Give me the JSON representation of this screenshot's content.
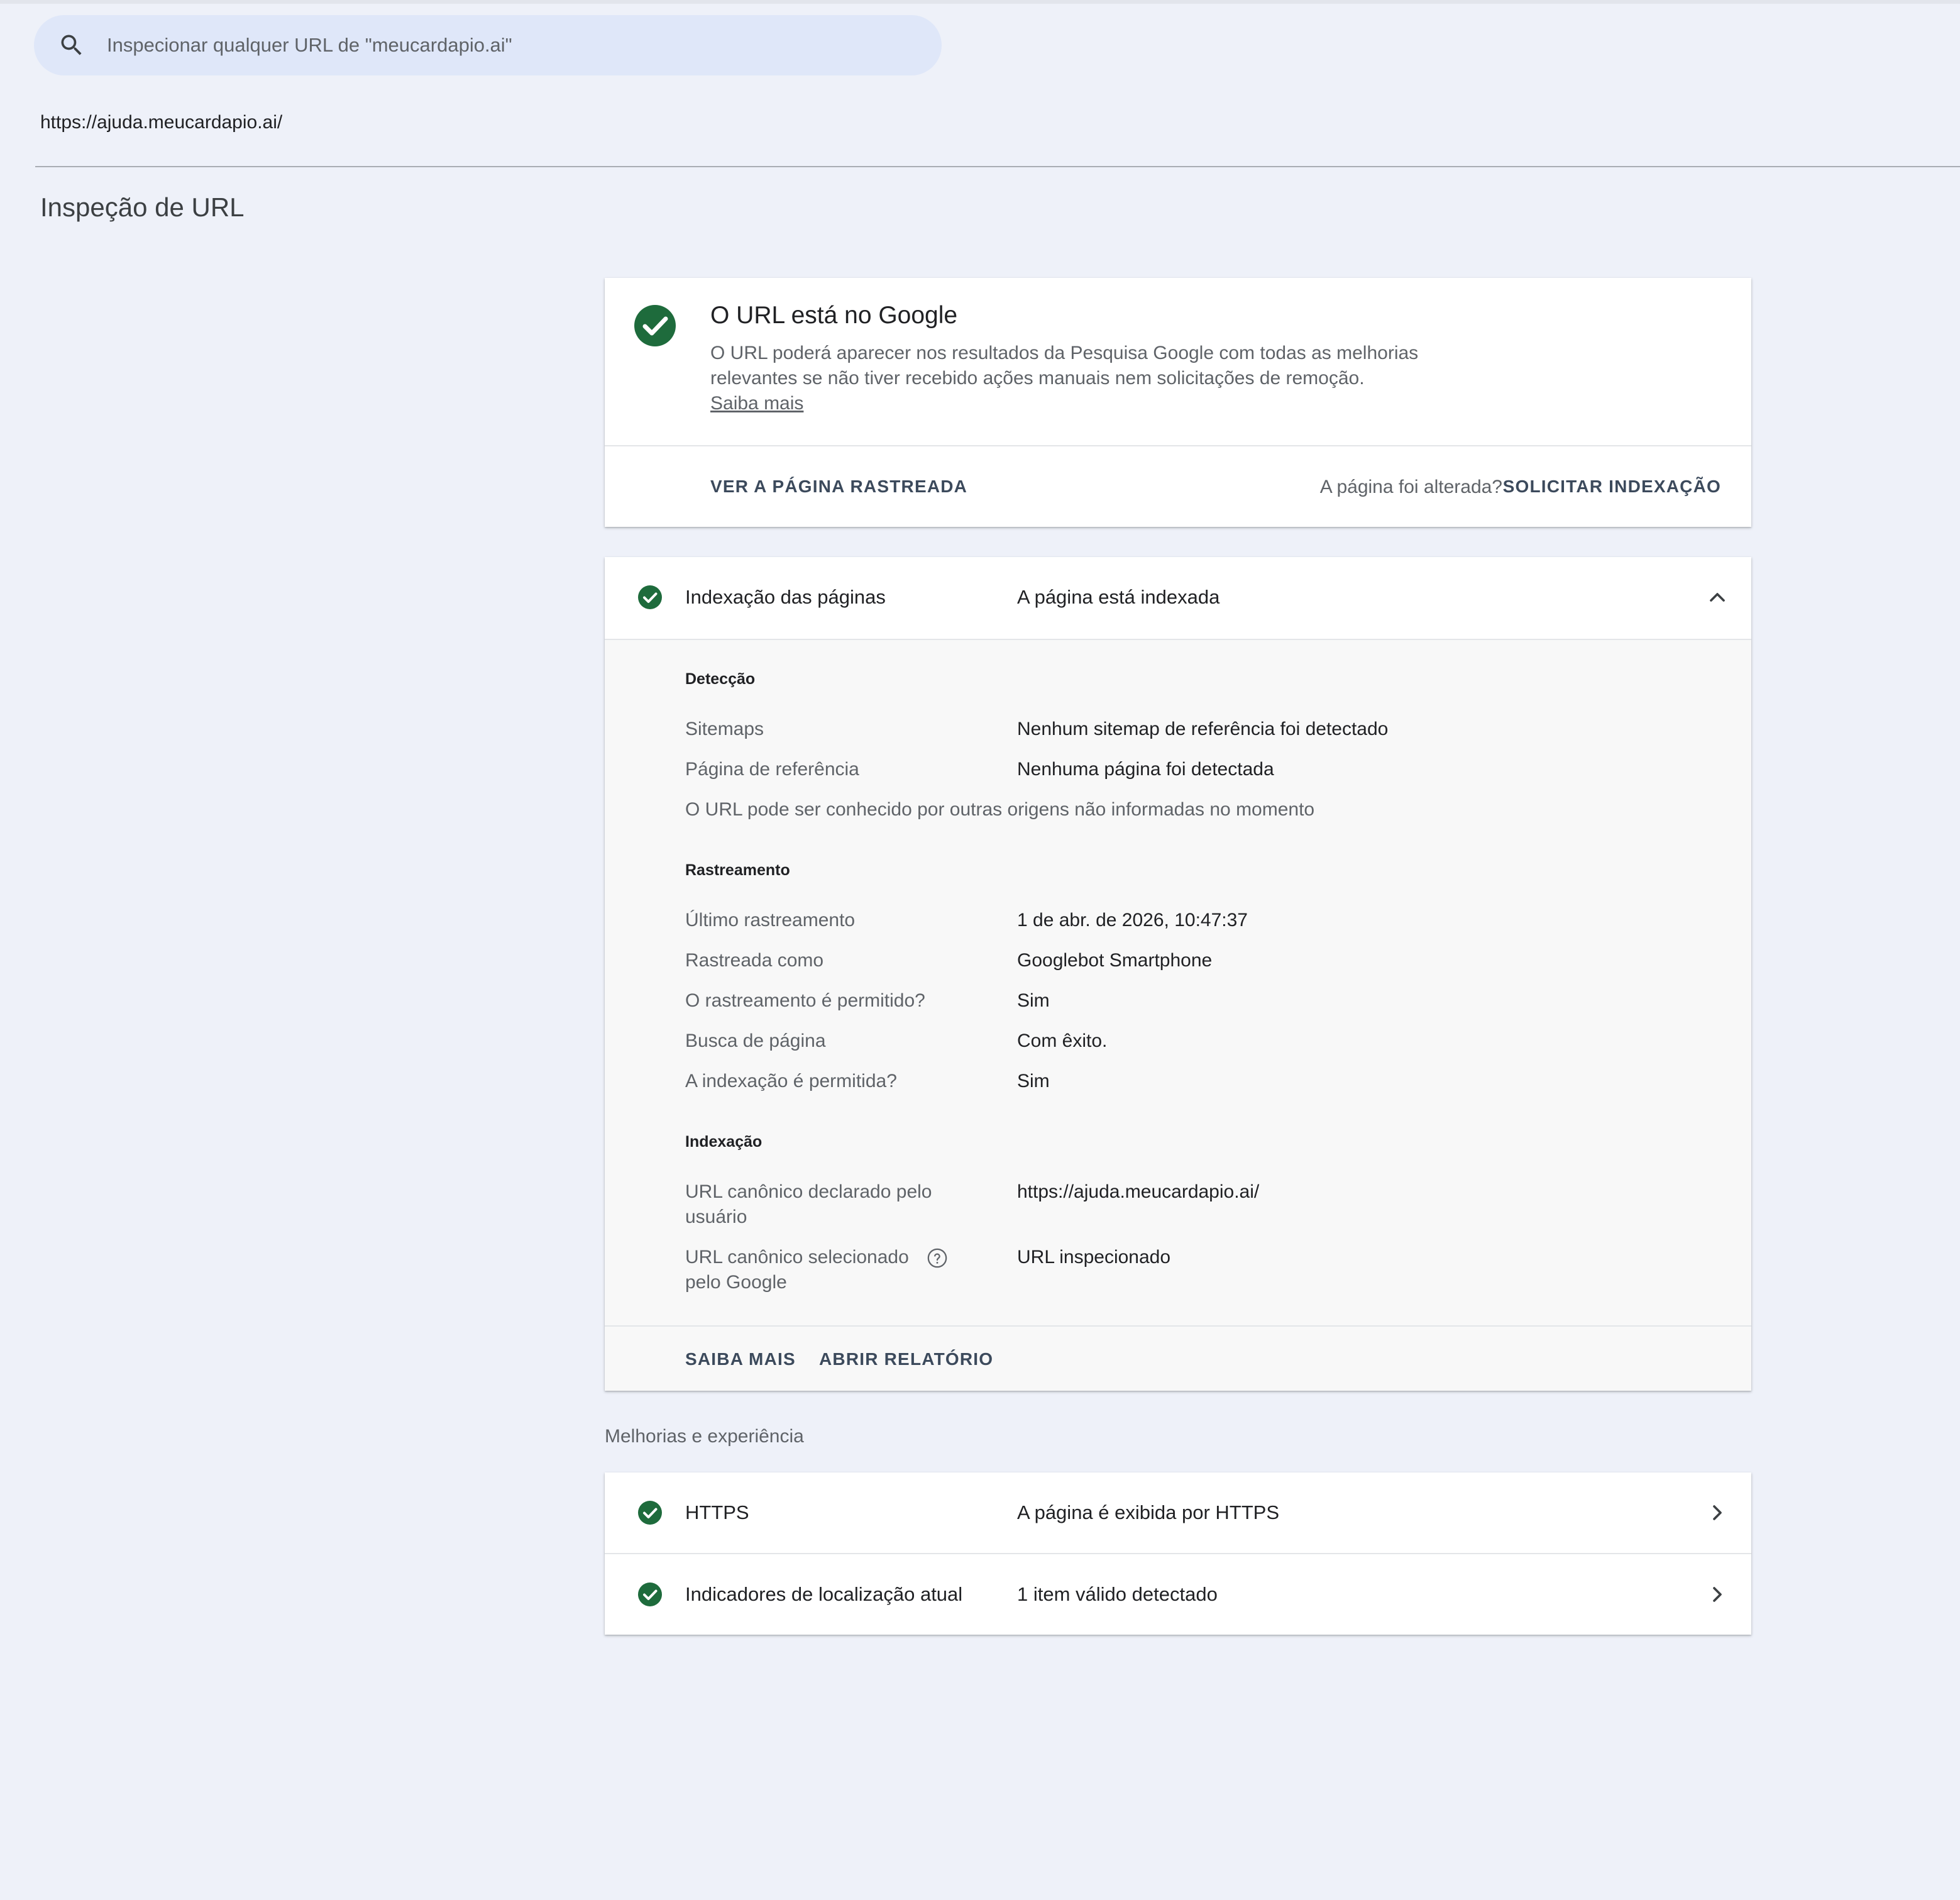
{
  "search": {
    "placeholder": "Inspecionar qualquer URL de \"meucardapio.ai\""
  },
  "inspected_url": "https://ajuda.meucardapio.ai/",
  "page_title": "Inspeção de URL",
  "status": {
    "title": "O URL está no Google",
    "description_line1": "O URL poderá aparecer nos resultados da Pesquisa Google com todas as melhorias",
    "description_line2": "relevantes se não tiver recebido ações manuais nem solicitações de remoção.",
    "learn_more": "Saiba mais",
    "view_crawled_label": "VER A PÁGINA RASTREADA",
    "page_changed_text": "A página foi alterada?",
    "request_indexing_label": "SOLICITAR INDEXAÇÃO",
    "status_color": "#1e6b3c"
  },
  "indexing": {
    "label": "Indexação das páginas",
    "value": "A página está indexada",
    "detection": {
      "heading": "Detecção",
      "sitemaps_label": "Sitemaps",
      "sitemaps_value": "Nenhum sitemap de referência foi detectado",
      "referring_label": "Página de referência",
      "referring_value": "Nenhuma página foi detectada",
      "note": "O URL pode ser conhecido por outras origens não informadas no momento"
    },
    "crawl": {
      "heading": "Rastreamento",
      "last_crawl_label": "Último rastreamento",
      "last_crawl_value": "1 de abr. de 2026, 10:47:37",
      "crawled_as_label": "Rastreada como",
      "crawled_as_value": "Googlebot Smartphone",
      "crawl_allowed_label": "O rastreamento é permitido?",
      "crawl_allowed_value": "Sim",
      "page_fetch_label": "Busca de página",
      "page_fetch_value": "Com êxito.",
      "index_allowed_label": "A indexação é permitida?",
      "index_allowed_value": "Sim"
    },
    "indexing_section": {
      "heading": "Indexação",
      "user_canonical_label_line1": "URL canônico declarado pelo",
      "user_canonical_label_line2": "usuário",
      "user_canonical_value": "https://ajuda.meucardapio.ai/",
      "google_canonical_label_line1": "URL canônico selecionado",
      "google_canonical_label_line2": "pelo Google",
      "google_canonical_value": "URL inspecionado"
    },
    "learn_more_label": "SAIBA MAIS",
    "open_report_label": "ABRIR RELATÓRIO"
  },
  "enhancements": {
    "caption": "Melhorias e experiência",
    "items": [
      {
        "label": "HTTPS",
        "value": "A página é exibida por HTTPS"
      },
      {
        "label": "Indicadores de localização atual",
        "value": "1 item válido detectado"
      }
    ]
  },
  "colors": {
    "background": "#eef1f9",
    "search_bg": "#dfe7f9",
    "success_green": "#1e6b3c",
    "button_text": "#3c4a5c"
  }
}
